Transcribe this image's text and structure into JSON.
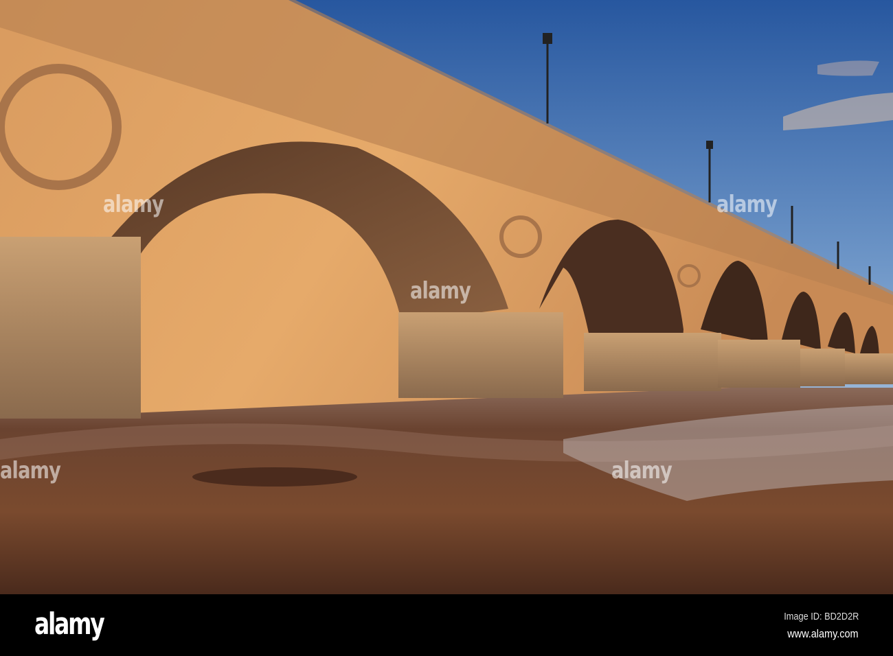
{
  "photo": {
    "subject": "Stone arch bridge over river weir at sunset",
    "colors": {
      "sky_top": "#2d5fa8",
      "sky_bottom": "#d9e4ee",
      "stone_lit": "#e0a060",
      "stone_shadow": "#6b4a33",
      "water": "#5a3522",
      "trees": "#3e7a2c"
    }
  },
  "watermark": {
    "text": "alamy"
  },
  "footer": {
    "logo": "alamy",
    "image_id": "Image ID: BD2D2R",
    "website": "www.alamy.com"
  }
}
